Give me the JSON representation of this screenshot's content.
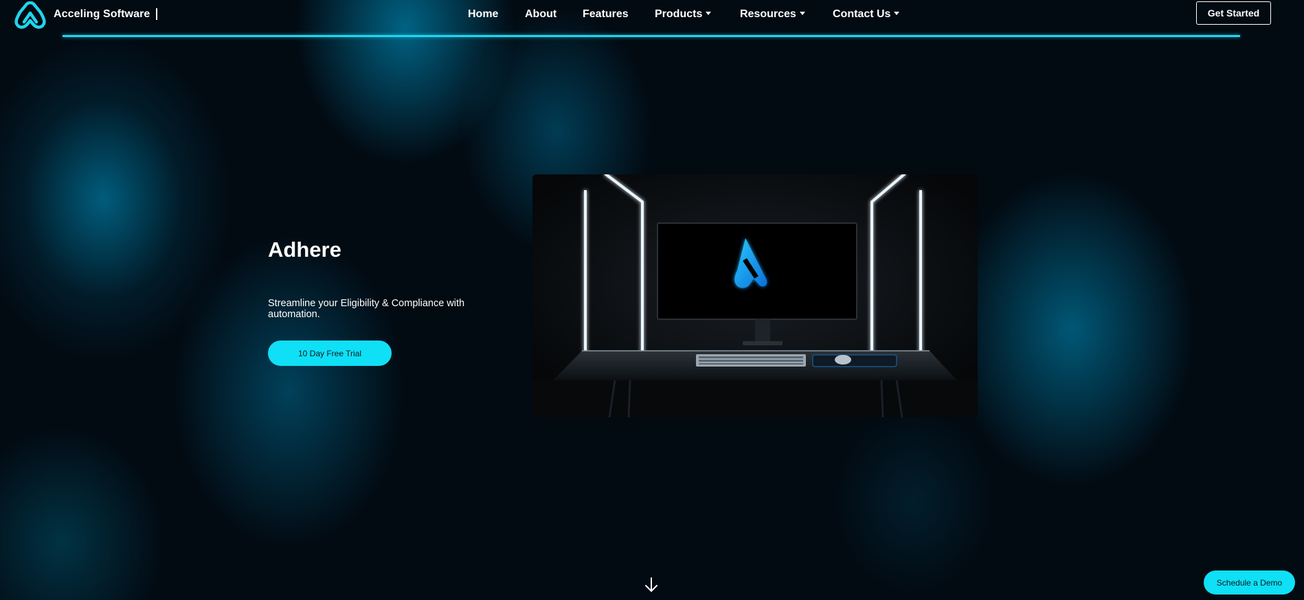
{
  "header": {
    "brand": "Acceling Software",
    "nav": [
      {
        "label": "Home",
        "dropdown": false
      },
      {
        "label": "About",
        "dropdown": false
      },
      {
        "label": "Features",
        "dropdown": false
      },
      {
        "label": "Products",
        "dropdown": true
      },
      {
        "label": "Resources",
        "dropdown": true
      },
      {
        "label": "Contact Us",
        "dropdown": true
      }
    ],
    "cta_label": "Get Started"
  },
  "hero": {
    "title": "Adhere",
    "subtitle": "Streamline your Eligibility & Compliance with automation.",
    "trial_label": "10 Day Free Trial",
    "image": "desk-monitor-logo-photo"
  },
  "footer": {
    "scroll_icon": "arrow-down-icon",
    "demo_label": "Schedule a Demo"
  },
  "colors": {
    "accent": "#0fe0f5",
    "header_line": "#1fd6ef",
    "background": "#020a12",
    "glow": "#0088b0"
  }
}
